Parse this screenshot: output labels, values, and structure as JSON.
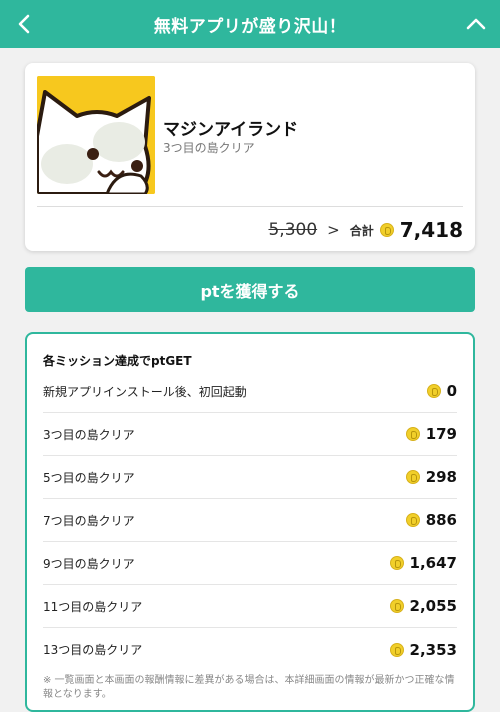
{
  "header": {
    "title": "無料アプリが盛り沢山！",
    "back_icon": "chevron-left-icon",
    "collapse_icon": "chevron-up-icon"
  },
  "app": {
    "name": "マジンアイランド",
    "subtitle": "3つ目の島クリア",
    "icon": "cat-character-icon",
    "old_points": "5,300",
    "arrow": ">",
    "total_label": "合計",
    "total_points": "7,418"
  },
  "cta": {
    "label": "ptを獲得する"
  },
  "missions": {
    "title": "各ミッション達成でptGET",
    "items": [
      {
        "label": "新規アプリインストール後、初回起動",
        "points": "0"
      },
      {
        "label": "3つ目の島クリア",
        "points": "179"
      },
      {
        "label": "5つ目の島クリア",
        "points": "298"
      },
      {
        "label": "7つ目の島クリア",
        "points": "886"
      },
      {
        "label": "9つ目の島クリア",
        "points": "1,647"
      },
      {
        "label": "11つ目の島クリア",
        "points": "2,055"
      },
      {
        "label": "13つ目の島クリア",
        "points": "2,353"
      }
    ],
    "note": "※ 一覧画面と本画面の報酬情報に差異がある場合は、本詳細画面の情報が最新かつ正確な情報となります。"
  },
  "colors": {
    "accent": "#2fb79d",
    "coin": "#f1cf2a",
    "icon_bg": "#f7c81e"
  }
}
